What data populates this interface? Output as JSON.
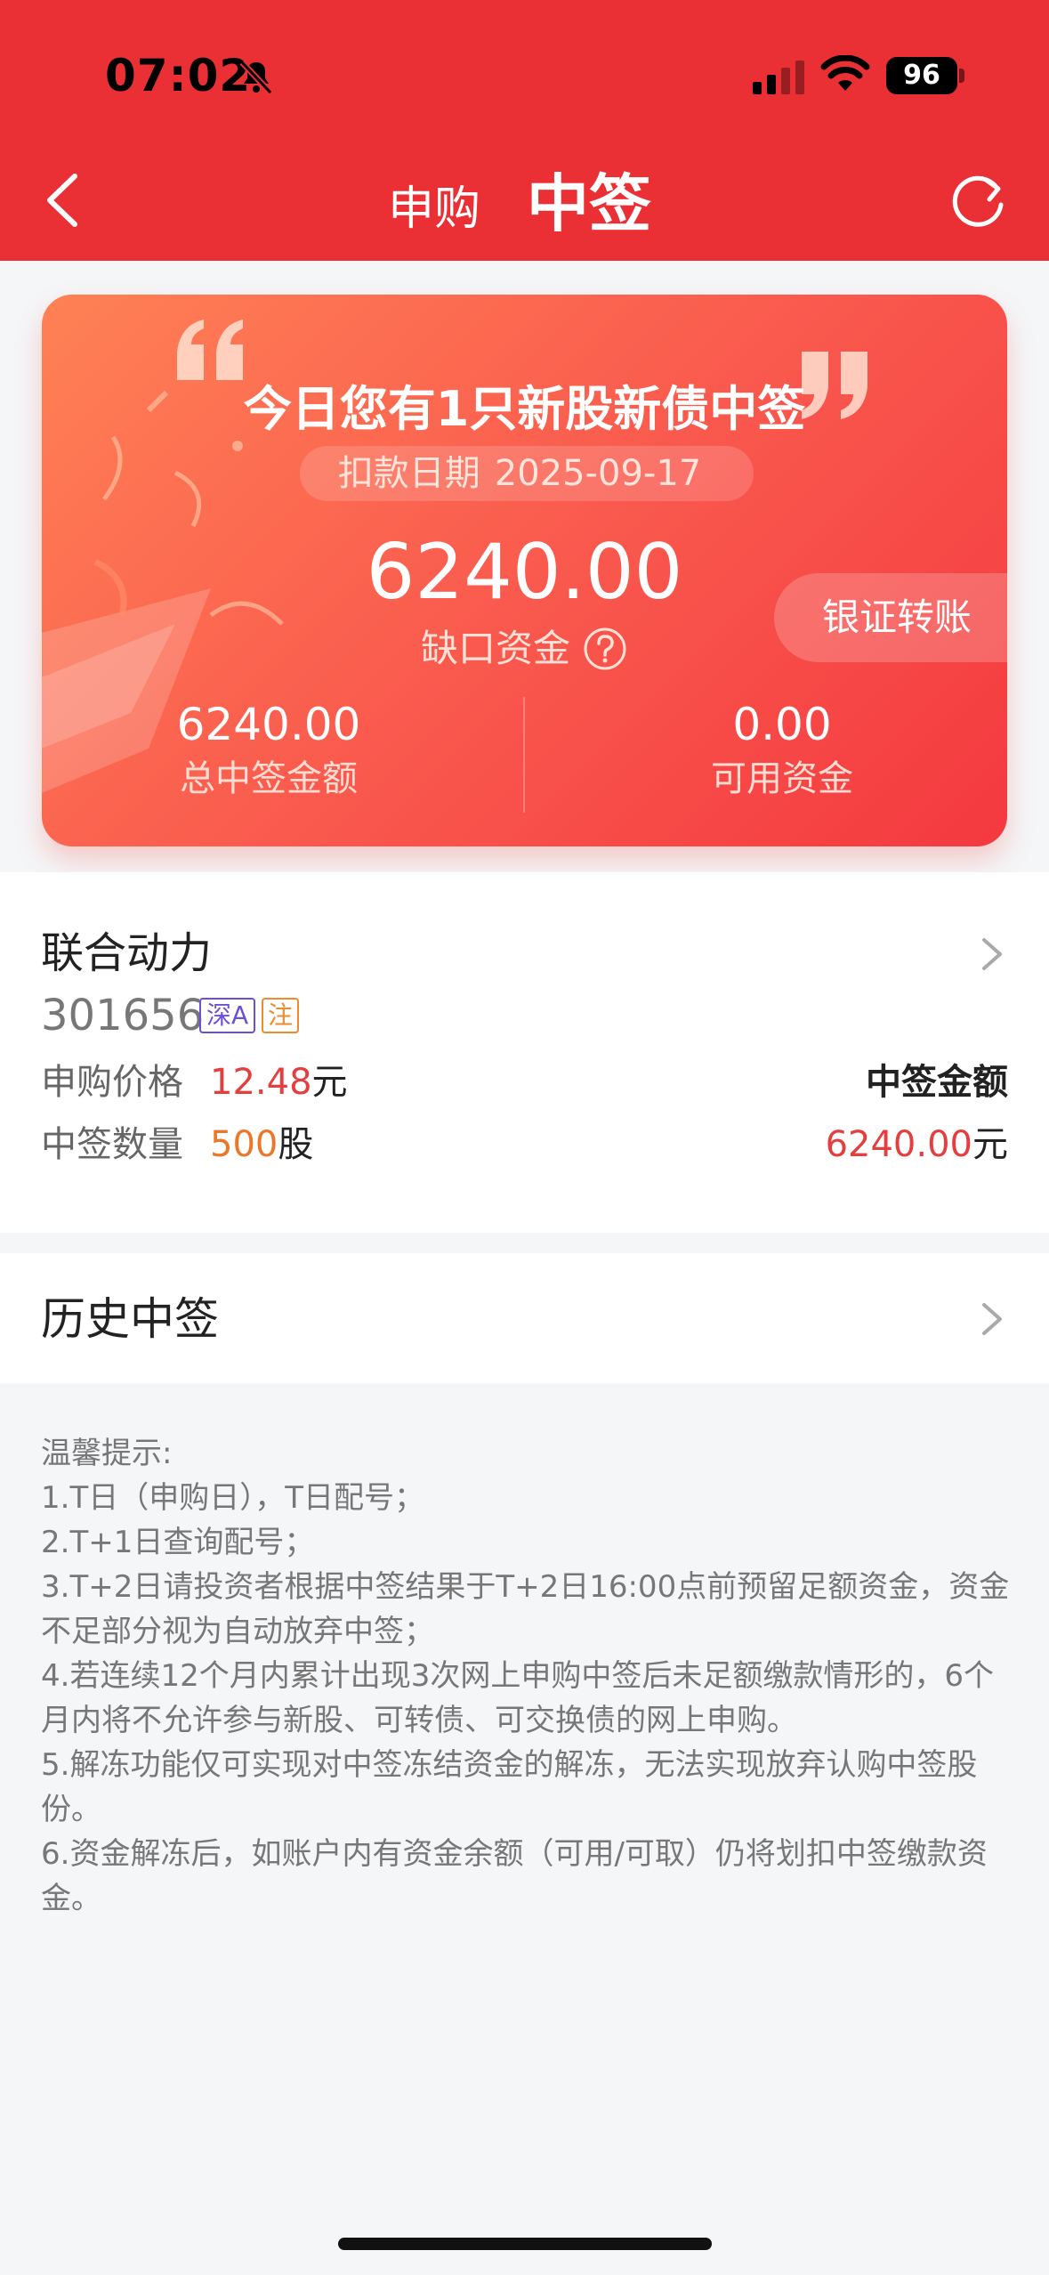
{
  "status_bar": {
    "time": "07:02",
    "battery": "96"
  },
  "nav": {
    "tab_apply": "申购",
    "tab_win": "中签"
  },
  "summary": {
    "title": "今日您有1只新股新债中签",
    "date_label": "扣款日期",
    "date_value": "2025-09-17",
    "gap_amount": "6240.00",
    "gap_label": "缺口资金",
    "transfer_button": "银证转账",
    "total_win_value": "6240.00",
    "total_win_label": "总中签金额",
    "available_value": "0.00",
    "available_label": "可用资金"
  },
  "stock": {
    "name": "联合动力",
    "code": "301656",
    "tag_market": "深A",
    "tag_note": "注",
    "price_label": "申购价格",
    "price_value": "12.48",
    "price_unit": "元",
    "qty_label": "中签数量",
    "qty_value": "500",
    "qty_unit": "股",
    "win_amount_label": "中签金额",
    "win_amount_value": "6240.00",
    "win_amount_unit": "元"
  },
  "history": {
    "label": "历史中签"
  },
  "tips": {
    "title": "温馨提示:",
    "items": [
      "1.T日（申购日），T日配号；",
      "2.T+1日查询配号；",
      "3.T+2日请投资者根据中签结果于T+2日16:00点前预留足额资金，资金不足部分视为自动放弃中签；",
      "4.若连续12个月内累计出现3次网上申购中签后未足额缴款情形的，6个月内将不允许参与新股、可转债、可交换债的网上申购。",
      "5.解冻功能仅可实现对中签冻结资金的解冻，无法实现放弃认购中签股份。",
      "6.资金解冻后，如账户内有资金余额（可用/可取）仍将划扣中签缴款资金。"
    ]
  },
  "colors": {
    "header_red": "#ea2f35",
    "price_red": "#e53e3e",
    "qty_orange": "#e9782a"
  }
}
